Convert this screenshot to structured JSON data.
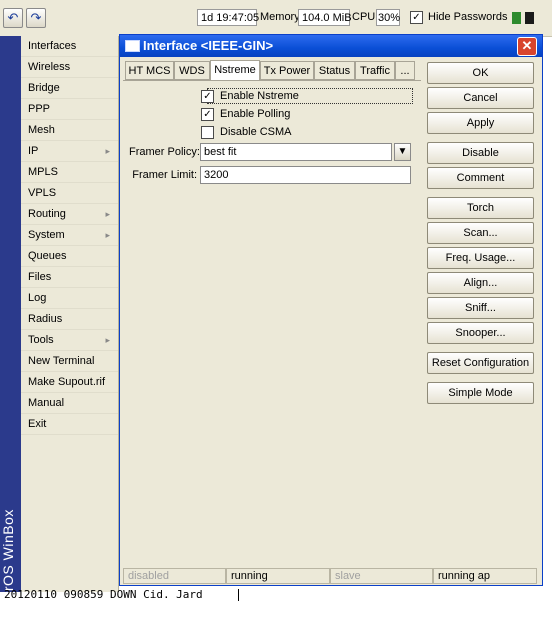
{
  "toolbar": {
    "undo_icon": "undo-icon",
    "redo_icon": "redo-icon",
    "uptime": "1d 19:47:05",
    "memory_label": "Memory:",
    "memory_value": "104.0 MiB",
    "cpu_label": "CPU:",
    "cpu_value": "30%",
    "hide_passwords_label": "Hide Passwords",
    "hide_passwords_checked": true,
    "indicator_colors": [
      "#2e8b2e",
      "#1a1a1a"
    ]
  },
  "brand": "RouterOS WinBox",
  "menu": {
    "items": [
      {
        "label": "Interfaces",
        "submenu": false
      },
      {
        "label": "Wireless",
        "submenu": false
      },
      {
        "label": "Bridge",
        "submenu": false
      },
      {
        "label": "PPP",
        "submenu": false
      },
      {
        "label": "Mesh",
        "submenu": false
      },
      {
        "label": "IP",
        "submenu": true
      },
      {
        "label": "MPLS",
        "submenu": false
      },
      {
        "label": "VPLS",
        "submenu": false
      },
      {
        "label": "Routing",
        "submenu": true
      },
      {
        "label": "System",
        "submenu": true
      },
      {
        "label": "Queues",
        "submenu": false
      },
      {
        "label": "Files",
        "submenu": false
      },
      {
        "label": "Log",
        "submenu": false
      },
      {
        "label": "Radius",
        "submenu": false
      },
      {
        "label": "Tools",
        "submenu": true
      },
      {
        "label": "New Terminal",
        "submenu": false
      },
      {
        "label": "Make Supout.rif",
        "submenu": false
      },
      {
        "label": "Manual",
        "submenu": false
      },
      {
        "label": "Exit",
        "submenu": false
      }
    ]
  },
  "window": {
    "title": "Interface <IEEE-GIN>",
    "close_glyph": "✕",
    "tabs": [
      "HT MCS",
      "WDS",
      "Nstreme",
      "Tx Power",
      "Status",
      "Traffic",
      "..."
    ],
    "active_tab": "Nstreme",
    "checkboxes": [
      {
        "label": "Enable Nstreme",
        "checked": true
      },
      {
        "label": "Enable Polling",
        "checked": true
      },
      {
        "label": "Disable CSMA",
        "checked": false
      }
    ],
    "framer_policy": {
      "label": "Framer Policy:",
      "value": "best fit"
    },
    "framer_limit": {
      "label": "Framer Limit:",
      "value": "3200"
    },
    "buttons": [
      "OK",
      "Cancel",
      "Apply",
      "Disable",
      "Comment",
      "Torch",
      "Scan...",
      "Freq. Usage...",
      "Align...",
      "Sniff...",
      "Snooper...",
      "Reset Configuration",
      "Simple Mode"
    ],
    "status": [
      "disabled",
      "running",
      "slave",
      "running ap"
    ]
  },
  "footer": "20120110 090859 DOWN Cid. Jard"
}
